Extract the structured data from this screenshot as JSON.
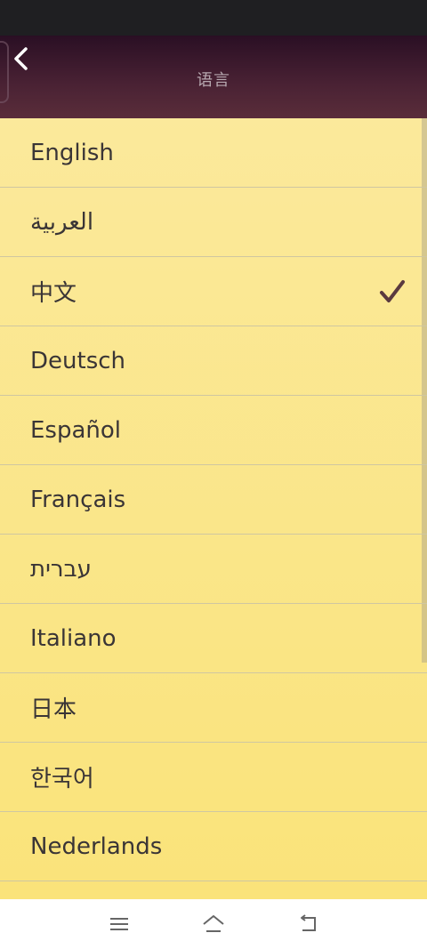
{
  "header": {
    "title": "语言",
    "back_icon": "chevron-left-icon"
  },
  "languages": {
    "items": [
      {
        "label": "English",
        "selected": false
      },
      {
        "label": "العربية",
        "selected": false
      },
      {
        "label": "中文",
        "selected": true
      },
      {
        "label": "Deutsch",
        "selected": false
      },
      {
        "label": "Español",
        "selected": false
      },
      {
        "label": "Français",
        "selected": false
      },
      {
        "label": "עברית",
        "selected": false
      },
      {
        "label": "Italiano",
        "selected": false
      },
      {
        "label": "日本",
        "selected": false
      },
      {
        "label": "한국어",
        "selected": false
      },
      {
        "label": "Nederlands",
        "selected": false
      }
    ]
  },
  "colors": {
    "header_top": "#2a0f24",
    "header_bottom": "#5a2d3a",
    "list_top": "#fbe99b",
    "list_bottom": "#fae37a",
    "checkmark": "#5a3a3f",
    "text": "#3a3536"
  },
  "nav": {
    "menu_icon": "menu-icon",
    "home_icon": "home-icon",
    "back_icon": "back-icon"
  }
}
